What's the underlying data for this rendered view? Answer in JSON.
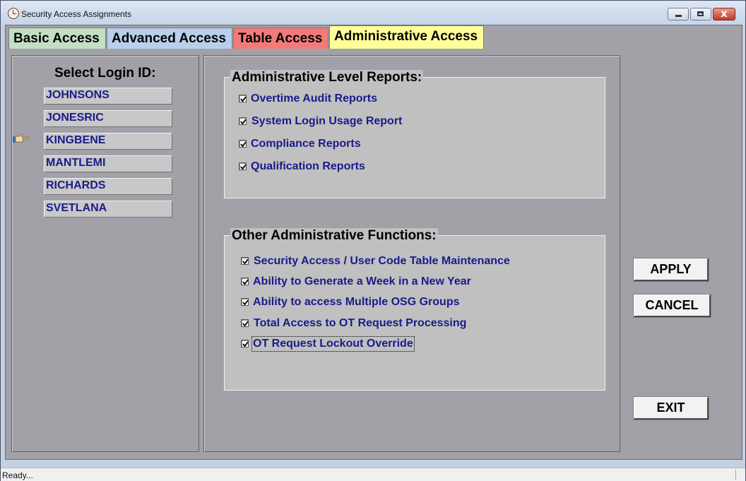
{
  "window": {
    "title": "Security Access Assignments",
    "controls": [
      "minimize-icon",
      "maximize-icon",
      "close-icon"
    ],
    "close_glyph": "x"
  },
  "tabs": [
    {
      "label": "Basic Access",
      "color": "#c3dfc3"
    },
    {
      "label": "Advanced Access",
      "color": "#b9d0ec"
    },
    {
      "label": "Table Access",
      "color": "#f47a7a"
    },
    {
      "label": "Administrative Access",
      "color": "#ffff99",
      "active": true
    }
  ],
  "login_panel": {
    "heading": "Select Login ID:",
    "ids": [
      "JOHNSONS",
      "JONESRIC",
      "KINGBENE",
      "MANTLEMI",
      "RICHARDS",
      "SVETLANA"
    ],
    "selected_index": 2,
    "pointer_icon": "pointing-hand-icon"
  },
  "reports_group": {
    "title": "Administrative Level Reports:",
    "options": [
      {
        "label": "Overtime Audit Reports",
        "checked": true
      },
      {
        "label": "System Login Usage Report",
        "checked": true
      },
      {
        "label": "Compliance Reports",
        "checked": true
      },
      {
        "label": "Qualification Reports",
        "checked": true
      }
    ]
  },
  "functions_group": {
    "title": "Other Administrative Functions:",
    "options": [
      {
        "label": "Security Access / User Code Table Maintenance",
        "checked": true
      },
      {
        "label": "Ability to Generate a Week in a New Year",
        "checked": true
      },
      {
        "label": "Ability to access Multiple OSG Groups",
        "checked": true
      },
      {
        "label": "Total Access to OT Request Processing",
        "checked": true
      },
      {
        "label": "OT Request Lockout Override",
        "checked": true,
        "focused": true
      }
    ]
  },
  "buttons": {
    "apply": "APPLY",
    "cancel": "CANCEL",
    "exit": "EXIT"
  },
  "status": {
    "text": "Ready..."
  }
}
